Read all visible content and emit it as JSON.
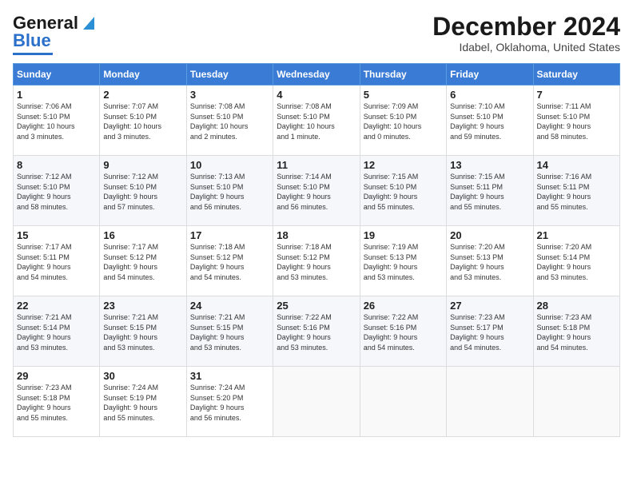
{
  "header": {
    "logo_line1": "General",
    "logo_line2": "Blue",
    "title": "December 2024",
    "subtitle": "Idabel, Oklahoma, United States"
  },
  "days_of_week": [
    "Sunday",
    "Monday",
    "Tuesday",
    "Wednesday",
    "Thursday",
    "Friday",
    "Saturday"
  ],
  "weeks": [
    [
      {
        "day": "1",
        "info": "Sunrise: 7:06 AM\nSunset: 5:10 PM\nDaylight: 10 hours\nand 3 minutes."
      },
      {
        "day": "2",
        "info": "Sunrise: 7:07 AM\nSunset: 5:10 PM\nDaylight: 10 hours\nand 3 minutes."
      },
      {
        "day": "3",
        "info": "Sunrise: 7:08 AM\nSunset: 5:10 PM\nDaylight: 10 hours\nand 2 minutes."
      },
      {
        "day": "4",
        "info": "Sunrise: 7:08 AM\nSunset: 5:10 PM\nDaylight: 10 hours\nand 1 minute."
      },
      {
        "day": "5",
        "info": "Sunrise: 7:09 AM\nSunset: 5:10 PM\nDaylight: 10 hours\nand 0 minutes."
      },
      {
        "day": "6",
        "info": "Sunrise: 7:10 AM\nSunset: 5:10 PM\nDaylight: 9 hours\nand 59 minutes."
      },
      {
        "day": "7",
        "info": "Sunrise: 7:11 AM\nSunset: 5:10 PM\nDaylight: 9 hours\nand 58 minutes."
      }
    ],
    [
      {
        "day": "8",
        "info": "Sunrise: 7:12 AM\nSunset: 5:10 PM\nDaylight: 9 hours\nand 58 minutes."
      },
      {
        "day": "9",
        "info": "Sunrise: 7:12 AM\nSunset: 5:10 PM\nDaylight: 9 hours\nand 57 minutes."
      },
      {
        "day": "10",
        "info": "Sunrise: 7:13 AM\nSunset: 5:10 PM\nDaylight: 9 hours\nand 56 minutes."
      },
      {
        "day": "11",
        "info": "Sunrise: 7:14 AM\nSunset: 5:10 PM\nDaylight: 9 hours\nand 56 minutes."
      },
      {
        "day": "12",
        "info": "Sunrise: 7:15 AM\nSunset: 5:10 PM\nDaylight: 9 hours\nand 55 minutes."
      },
      {
        "day": "13",
        "info": "Sunrise: 7:15 AM\nSunset: 5:11 PM\nDaylight: 9 hours\nand 55 minutes."
      },
      {
        "day": "14",
        "info": "Sunrise: 7:16 AM\nSunset: 5:11 PM\nDaylight: 9 hours\nand 55 minutes."
      }
    ],
    [
      {
        "day": "15",
        "info": "Sunrise: 7:17 AM\nSunset: 5:11 PM\nDaylight: 9 hours\nand 54 minutes."
      },
      {
        "day": "16",
        "info": "Sunrise: 7:17 AM\nSunset: 5:12 PM\nDaylight: 9 hours\nand 54 minutes."
      },
      {
        "day": "17",
        "info": "Sunrise: 7:18 AM\nSunset: 5:12 PM\nDaylight: 9 hours\nand 54 minutes."
      },
      {
        "day": "18",
        "info": "Sunrise: 7:18 AM\nSunset: 5:12 PM\nDaylight: 9 hours\nand 53 minutes."
      },
      {
        "day": "19",
        "info": "Sunrise: 7:19 AM\nSunset: 5:13 PM\nDaylight: 9 hours\nand 53 minutes."
      },
      {
        "day": "20",
        "info": "Sunrise: 7:20 AM\nSunset: 5:13 PM\nDaylight: 9 hours\nand 53 minutes."
      },
      {
        "day": "21",
        "info": "Sunrise: 7:20 AM\nSunset: 5:14 PM\nDaylight: 9 hours\nand 53 minutes."
      }
    ],
    [
      {
        "day": "22",
        "info": "Sunrise: 7:21 AM\nSunset: 5:14 PM\nDaylight: 9 hours\nand 53 minutes."
      },
      {
        "day": "23",
        "info": "Sunrise: 7:21 AM\nSunset: 5:15 PM\nDaylight: 9 hours\nand 53 minutes."
      },
      {
        "day": "24",
        "info": "Sunrise: 7:21 AM\nSunset: 5:15 PM\nDaylight: 9 hours\nand 53 minutes."
      },
      {
        "day": "25",
        "info": "Sunrise: 7:22 AM\nSunset: 5:16 PM\nDaylight: 9 hours\nand 53 minutes."
      },
      {
        "day": "26",
        "info": "Sunrise: 7:22 AM\nSunset: 5:16 PM\nDaylight: 9 hours\nand 54 minutes."
      },
      {
        "day": "27",
        "info": "Sunrise: 7:23 AM\nSunset: 5:17 PM\nDaylight: 9 hours\nand 54 minutes."
      },
      {
        "day": "28",
        "info": "Sunrise: 7:23 AM\nSunset: 5:18 PM\nDaylight: 9 hours\nand 54 minutes."
      }
    ],
    [
      {
        "day": "29",
        "info": "Sunrise: 7:23 AM\nSunset: 5:18 PM\nDaylight: 9 hours\nand 55 minutes."
      },
      {
        "day": "30",
        "info": "Sunrise: 7:24 AM\nSunset: 5:19 PM\nDaylight: 9 hours\nand 55 minutes."
      },
      {
        "day": "31",
        "info": "Sunrise: 7:24 AM\nSunset: 5:20 PM\nDaylight: 9 hours\nand 56 minutes."
      },
      {
        "day": "",
        "info": ""
      },
      {
        "day": "",
        "info": ""
      },
      {
        "day": "",
        "info": ""
      },
      {
        "day": "",
        "info": ""
      }
    ]
  ]
}
